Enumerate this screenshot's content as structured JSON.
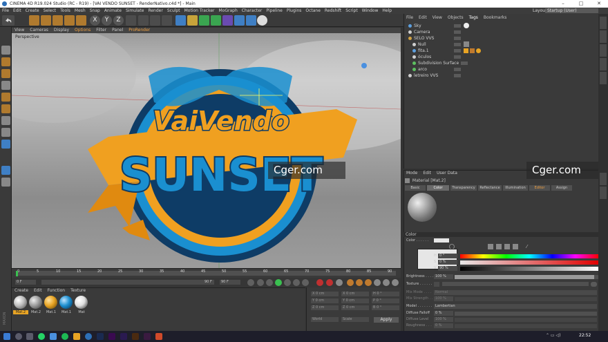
{
  "window": {
    "title": "CINEMA 4D R19.024 Studio (RC - R19) - [VAI VENDO SUNSET - RenderNativo.c4d *] - Main",
    "controls": [
      "–",
      "□",
      "✕"
    ]
  },
  "menubar": {
    "items": [
      "File",
      "Edit",
      "Create",
      "Select",
      "Tools",
      "Mesh",
      "Snap",
      "Animate",
      "Simulate",
      "Render",
      "Sculpt",
      "Motion Tracker",
      "MoGraph",
      "Character",
      "Pipeline",
      "Plugins",
      "Octane",
      "Redshift",
      "Script",
      "Window",
      "Help"
    ],
    "layout_label": "Layout:",
    "layout_value": "Startup (User)"
  },
  "toolbar": {
    "axis_labels": [
      "X",
      "Y",
      "Z"
    ]
  },
  "viewport": {
    "menu": [
      "View",
      "Cameras",
      "Display",
      "Options",
      "Filter",
      "Panel",
      "ProRender"
    ],
    "label": "Perspective",
    "artwork": {
      "line1": "VaiVendo",
      "line2": "SUNSET",
      "colors": {
        "blue": "#1a8fd0",
        "dark": "#0e3c66",
        "orange": "#f0a020"
      }
    }
  },
  "timeline": {
    "ticks": [
      "0",
      "5",
      "10",
      "15",
      "20",
      "25",
      "30",
      "35",
      "40",
      "45",
      "50",
      "55",
      "60",
      "65",
      "70",
      "75",
      "80",
      "85",
      "90"
    ],
    "start": "0 F",
    "current": "0 F",
    "end": "90 F",
    "end2": "90 F"
  },
  "materials": {
    "menu": [
      "Create",
      "Edit",
      "Function",
      "Texture"
    ],
    "items": [
      {
        "name": "Mat.2",
        "color": "#bdbdbd",
        "selected": true
      },
      {
        "name": "Mat.2",
        "color": "#9c9c9c",
        "selected": false
      },
      {
        "name": "Mat.1",
        "color": "#e8a424",
        "selected": false
      },
      {
        "name": "Mat.1",
        "color": "#1e90d0",
        "selected": false
      },
      {
        "name": "Mat",
        "color": "#e0e0e0",
        "selected": false
      }
    ]
  },
  "coordinates": {
    "rows": [
      {
        "a": "X  0 cm",
        "b": "X  0 cm",
        "c": "H  0 °"
      },
      {
        "a": "Y  0 cm",
        "b": "Y  0 cm",
        "c": "P  0 °"
      },
      {
        "a": "Z  0 cm",
        "b": "Z  0 cm",
        "c": "B  0 °"
      }
    ],
    "mode1": "World",
    "mode2": "Scale",
    "apply": "Apply"
  },
  "objects": {
    "menu": [
      "File",
      "Edit",
      "View",
      "Objects",
      "Tags",
      "Bookmarks"
    ],
    "items": [
      {
        "name": "Sky",
        "color": "#5da0e0"
      },
      {
        "name": "Camera",
        "color": "#cfcfcf"
      },
      {
        "name": "SELO VVS",
        "color": "#d0a040"
      },
      {
        "name": "Null",
        "color": "#cfcfcf"
      },
      {
        "name": "fita.1",
        "color": "#5da0e0"
      },
      {
        "name": "óculos",
        "color": "#cfcfcf"
      },
      {
        "name": "Subdivision Surface",
        "color": "#5dc060"
      },
      {
        "name": "arco",
        "color": "#5dc060"
      },
      {
        "name": "letreiro VVS",
        "color": "#cfcfcf"
      }
    ]
  },
  "attributes": {
    "menu": [
      "Mode",
      "Edit",
      "User Data"
    ],
    "header": "Material [Mat.2]",
    "tabs": [
      "Basic",
      "Color",
      "Transparency",
      "Reflectance",
      "Illumination",
      "Editor",
      "Assign"
    ],
    "selected_tab": "Color",
    "section": "Color",
    "color_label": "Color . . . . . .",
    "h_label": "H",
    "h_value": "0 °",
    "s_label": "S",
    "s_value": "0 %",
    "v_label": "V",
    "v_value": "90 %",
    "brightness_label": "Brightness . . . .",
    "brightness_value": "100 %",
    "brightness_fill": 0.97,
    "texture_label": "Texture . . . . . .",
    "mix_mode_label": "Mix Mode . . . .",
    "mix_mode_value": "Normal",
    "mix_strength_label": "Mix Strength . .",
    "mix_strength_value": "100 %",
    "model_label": "Model . . . . . . .",
    "model_value": "Lambertian",
    "diffuse_falloff_label": "Diffuse Falloff",
    "diffuse_falloff_value": "0 %",
    "diffuse_level_label": "Diffuse Level",
    "diffuse_level_value": "100 %",
    "roughness_label": "Roughness . . .",
    "roughness_value": "0 %"
  },
  "watermarks": [
    "Cger.com",
    "Cger.com"
  ],
  "taskbar": {
    "time": "22:52"
  }
}
